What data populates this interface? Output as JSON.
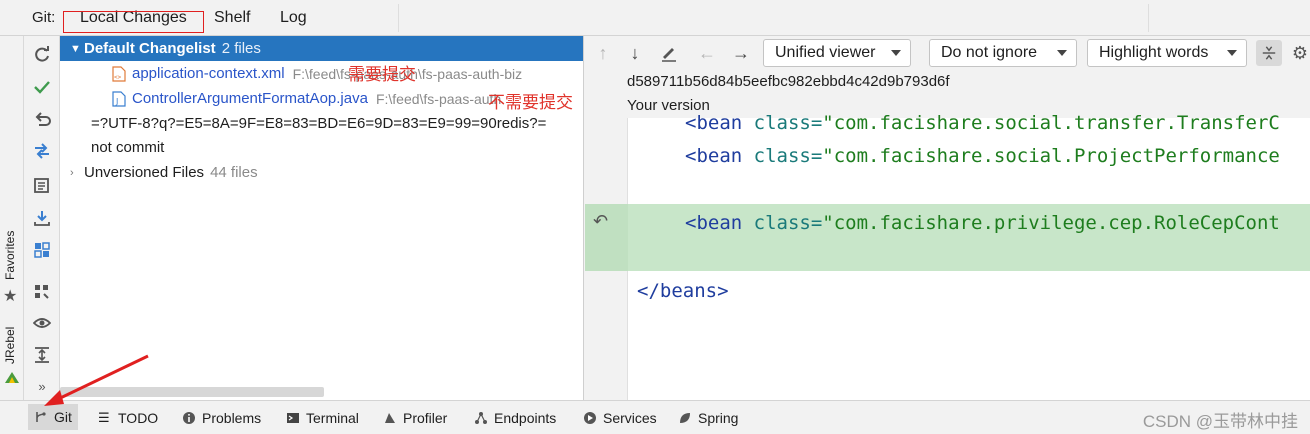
{
  "topbar": {
    "git_label": "Git:",
    "tabs": [
      "Local Changes",
      "Shelf",
      "Log"
    ]
  },
  "sidebar_outer": {
    "favorites": "Favorites",
    "jrebel": "JRebel"
  },
  "tree": {
    "changelist_name": "Default Changelist",
    "changelist_count": "2 files",
    "files": [
      {
        "name": "application-context.xml",
        "path": "F:\\feed\\fs-paas-auth\\fs-paas-auth-biz"
      },
      {
        "name": "ControllerArgumentFormatAop.java",
        "path": "F:\\feed\\fs-paas-auth"
      }
    ],
    "other_changelist_line1": "=?UTF-8?q?=E5=8A=9F=E8=83=BD=E6=9D=83=E9=99=90redis?=",
    "other_changelist_line2": "not commit",
    "unversioned_label": "Unversioned Files",
    "unversioned_count": "44 files",
    "annotation_commit": "需要提交",
    "annotation_no_commit": "不需要提交"
  },
  "diff": {
    "viewer": "Unified viewer",
    "ignore": "Do not ignore",
    "highlight": "Highlight words",
    "hash": "d589711b56d84b5eefbc982ebbd4c42d9b793d6f",
    "version_label": "Your version",
    "lines": [
      {
        "tag": "<bean",
        "attr": "class=",
        "value": "\"com.facishare.social.transfer.TransferC"
      },
      {
        "tag": "<bean",
        "attr": "class=",
        "value": "\"com.facishare.social.ProjectPerformance"
      },
      {
        "tag": "<bean",
        "attr": "class=",
        "value": "\"com.facishare.privilege.cep.RoleCepCont"
      },
      {
        "closing": "</beans>"
      }
    ]
  },
  "bottombar": {
    "tabs": [
      "Git",
      "TODO",
      "Problems",
      "Terminal",
      "Profiler",
      "Endpoints",
      "Services",
      "Spring"
    ],
    "watermark": "CSDN @玉带林中挂"
  },
  "colors": {
    "selection": "#2675bf",
    "added_line": "#c8e6c9",
    "annotation": "#e0332b",
    "link_blue": "#2a55c9"
  }
}
